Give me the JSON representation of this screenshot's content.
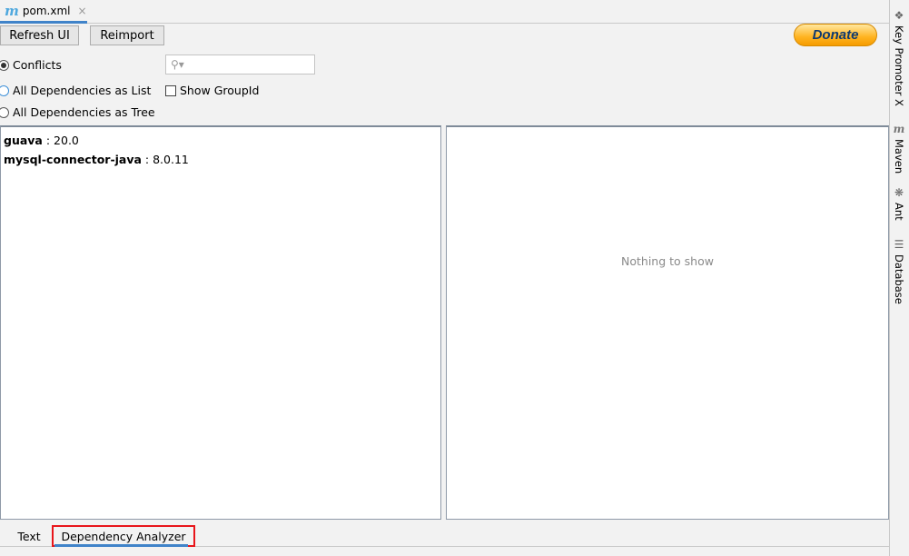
{
  "editor_tab": {
    "icon": "maven-icon",
    "label": "pom.xml",
    "close": "×"
  },
  "toolbar": {
    "refresh": "Refresh UI",
    "reimport": "Reimport",
    "donate": "Donate"
  },
  "options": {
    "conflicts": "Conflicts",
    "list": "All Dependencies as List",
    "tree": "All Dependencies as Tree",
    "show_group_id": "Show GroupId",
    "selected": "Conflicts",
    "show_group_id_checked": false
  },
  "search": {
    "icon": "search-icon",
    "value": ""
  },
  "dependencies": [
    {
      "name": "guava",
      "version": " : 20.0"
    },
    {
      "name": "mysql-connector-java",
      "version": " : 8.0.11"
    }
  ],
  "detail": {
    "empty": "Nothing to show"
  },
  "sidebar": [
    {
      "icon": "key-promoter-icon",
      "label": "Key Promoter X"
    },
    {
      "icon": "maven-icon",
      "label": "Maven"
    },
    {
      "icon": "ant-icon",
      "label": "Ant"
    },
    {
      "icon": "database-icon",
      "label": "Database"
    }
  ],
  "bottom_tabs": {
    "text": "Text",
    "analyzer": "Dependency Analyzer"
  },
  "colors": {
    "accent": "#4083c9",
    "highlight": "#e8161b",
    "donate": "#ffb320"
  }
}
